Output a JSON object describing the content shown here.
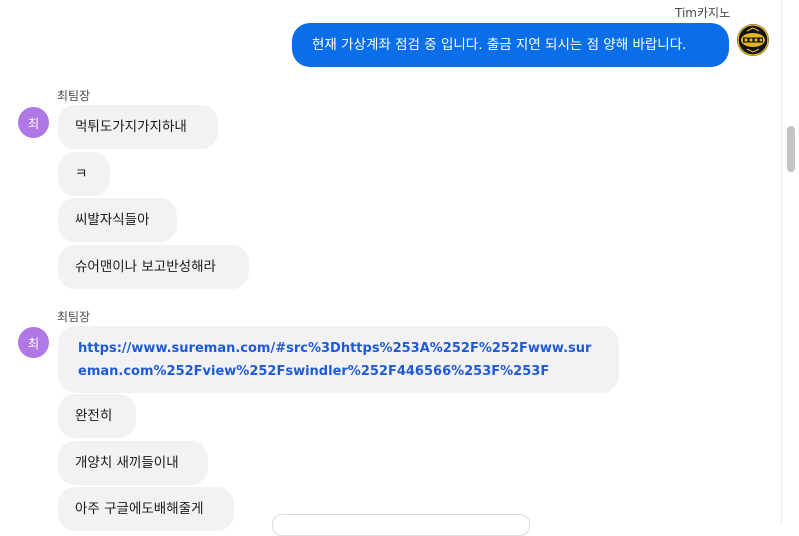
{
  "outgoing": {
    "sender_name": "Tim카지노",
    "message": "현재 가상계좌 점검 중 입니다. 출금 지연 되시는 점 양해 바랍니다."
  },
  "groups": [
    {
      "sender_name": "최팀장",
      "avatar_letter": "최",
      "messages": [
        "먹튀도가지가지하내",
        "ㅋ",
        "씨발자식들아",
        "슈어맨이나 보고반성해라"
      ]
    },
    {
      "sender_name": "최팀장",
      "avatar_letter": "최",
      "link": "https://www.sureman.com/#src%3Dhttps%253A%252F%252Fwww.sureman.com%252Fview%252Fswindler%252F446566%253F%253F",
      "messages": [
        "완전히",
        "개양치 새끼들이내",
        "아주 구글에도배해줄게"
      ]
    }
  ],
  "colors": {
    "outgoing_bubble": "#0a6ee8",
    "incoming_bubble": "#f2f2f4",
    "avatar": "#b077e6",
    "link_text": "#1f5bd6"
  }
}
